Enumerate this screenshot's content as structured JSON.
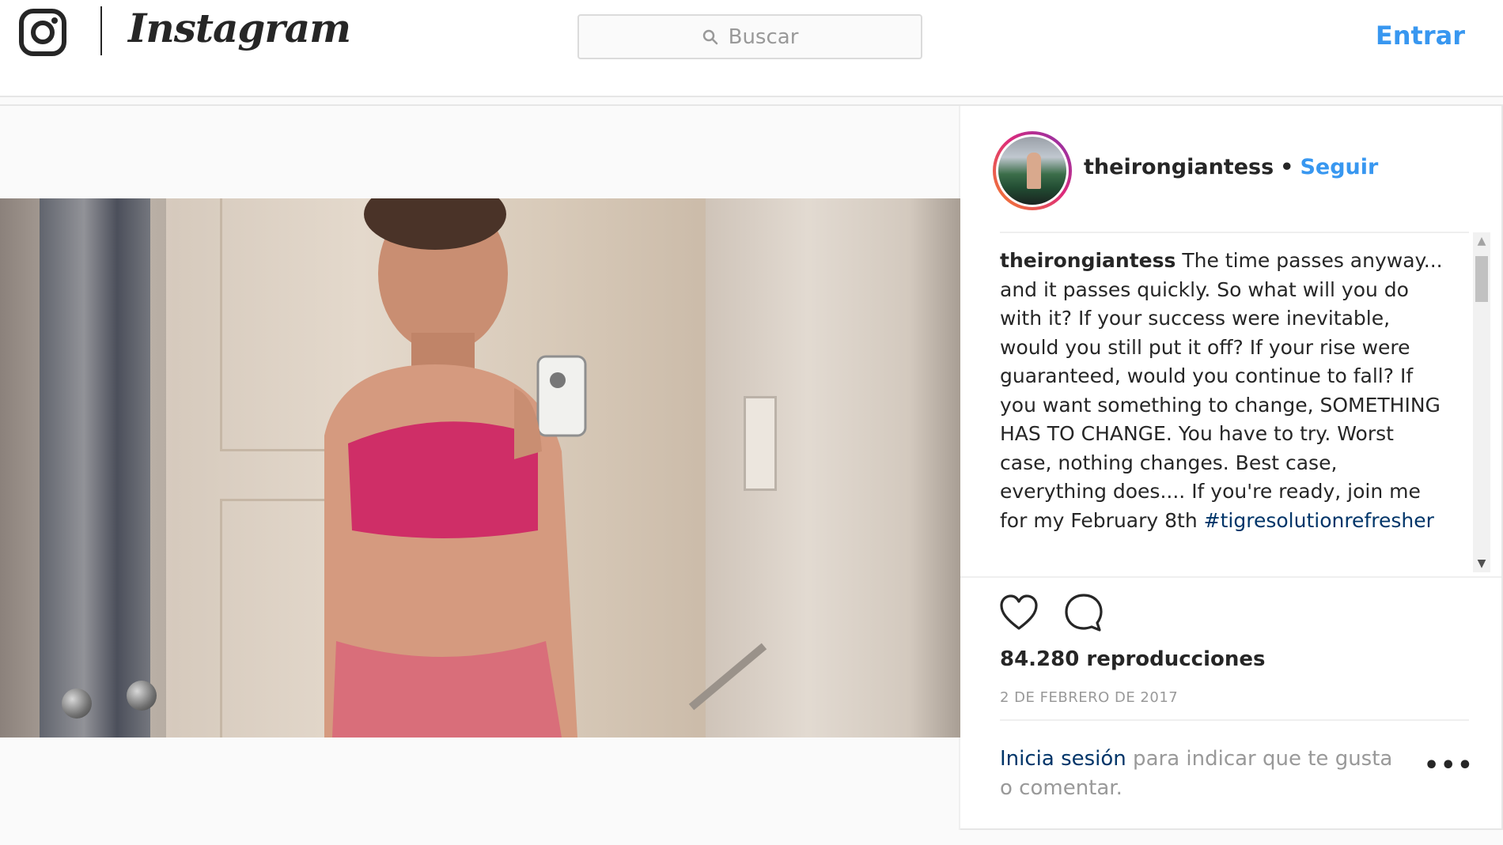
{
  "header": {
    "brand": "Instagram",
    "search_placeholder": "Buscar",
    "login_label": "Entrar"
  },
  "post": {
    "username": "theirongiantess",
    "separator": "•",
    "follow_label": "Seguir",
    "caption_text": "The time passes anyway... and it passes quickly. So what will you do with it? If your success were inevitable, would you still put it off? If your rise were guaranteed, would you continue to fall? If you want something to change, SOMETHING HAS TO CHANGE. You have to try. Worst case, nothing changes. Best case, everything does.... If you're ready, join me for my February 8th ",
    "caption_hashtag": "#tigresolutionrefresher",
    "views": "84.280 reproducciones",
    "date": "2 DE FEBRERO DE 2017",
    "login_prompt_link": "Inicia sesión",
    "login_prompt_rest": " para indicar que te gusta o comentar.",
    "more_label": "•••"
  },
  "colors": {
    "accent": "#3897f0",
    "link_dark": "#003569",
    "muted": "#999999"
  }
}
